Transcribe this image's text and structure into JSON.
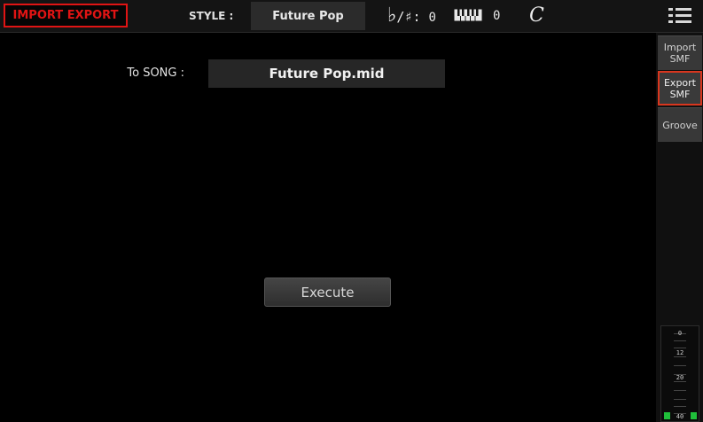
{
  "header": {
    "page_title": "IMPORT EXPORT",
    "style_label": "STYLE :",
    "style_value": "Future Pop",
    "key_signature_label": "♭/♯:",
    "key_signature_value": "0",
    "transpose_value": "0",
    "time_signature_symbol": "𝄴",
    "menu_icon": "hamburger-menu-icon"
  },
  "tabs": [
    {
      "label": "Import SMF",
      "line1": "Import",
      "line2": "SMF",
      "active": false
    },
    {
      "label": "Export SMF",
      "line1": "Export",
      "line2": "SMF",
      "active": true
    },
    {
      "label": "Groove",
      "line1": "Groove",
      "line2": "",
      "active": false
    }
  ],
  "main": {
    "to_song_label": "To SONG :",
    "to_song_value": "Future Pop.mid",
    "execute_label": "Execute"
  },
  "meter": {
    "scale_labels": [
      "0",
      "12",
      "20",
      "40"
    ],
    "left_level": 0.08,
    "right_level": 0.08
  },
  "colors": {
    "accent_red": "#e01414",
    "active_tab_border": "#d8361e",
    "meter_green": "#1fbf3a"
  }
}
